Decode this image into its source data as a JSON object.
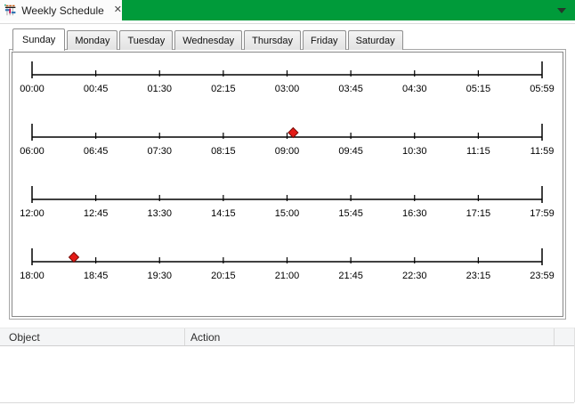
{
  "window_tab": {
    "title": "Weekly Schedule",
    "close_glyph": "✕"
  },
  "day_tabs": {
    "items": [
      {
        "label": "Sunday",
        "active": true
      },
      {
        "label": "Monday",
        "active": false
      },
      {
        "label": "Tuesday",
        "active": false
      },
      {
        "label": "Wednesday",
        "active": false
      },
      {
        "label": "Thursday",
        "active": false
      },
      {
        "label": "Friday",
        "active": false
      },
      {
        "label": "Saturday",
        "active": false
      }
    ]
  },
  "timeline": {
    "rows": [
      {
        "labels": [
          "00:00",
          "00:45",
          "01:30",
          "02:15",
          "03:00",
          "03:45",
          "04:30",
          "05:15",
          "05:59"
        ],
        "markers": []
      },
      {
        "labels": [
          "06:00",
          "06:45",
          "07:30",
          "08:15",
          "09:00",
          "09:45",
          "10:30",
          "11:15",
          "11:59"
        ],
        "markers": [
          {
            "fraction": 0.512,
            "approx_time": "09:05"
          }
        ]
      },
      {
        "labels": [
          "12:00",
          "12:45",
          "13:30",
          "14:15",
          "15:00",
          "15:45",
          "16:30",
          "17:15",
          "17:59"
        ],
        "markers": []
      },
      {
        "labels": [
          "18:00",
          "18:45",
          "19:30",
          "20:15",
          "21:00",
          "21:45",
          "22:30",
          "23:15",
          "23:59"
        ],
        "markers": [
          {
            "fraction": 0.082,
            "approx_time": "18:30"
          }
        ]
      }
    ],
    "marker_color": "#e41b17",
    "marker_border": "#7a0b06"
  },
  "table": {
    "columns": [
      "Object",
      "Action"
    ],
    "rows": []
  },
  "colors": {
    "accent_green": "#009b3a",
    "marker_red": "#e41b17"
  }
}
